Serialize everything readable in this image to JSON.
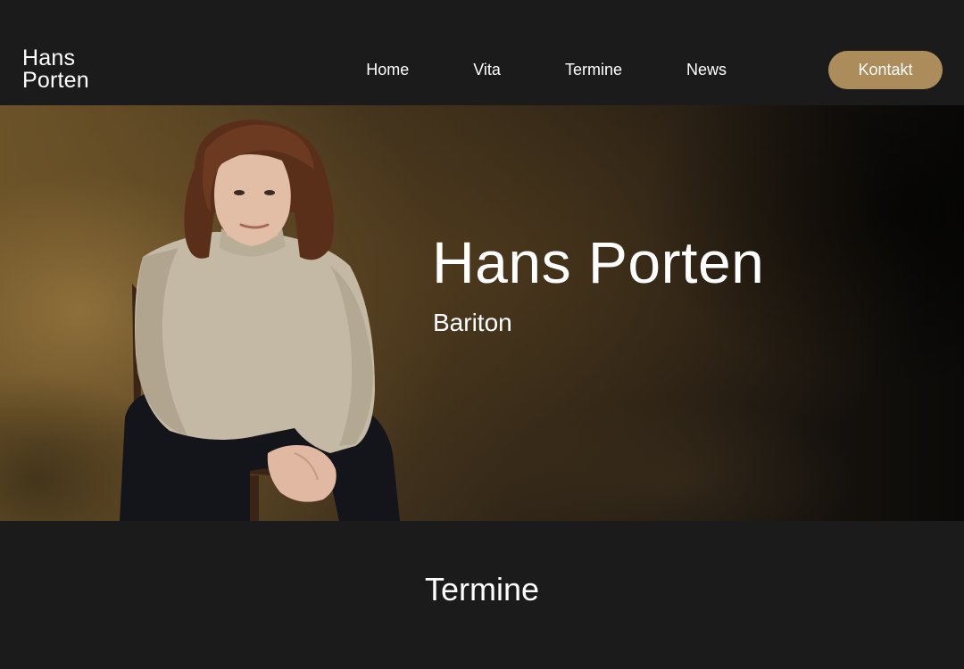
{
  "header": {
    "logo_line1": "Hans",
    "logo_line2": "Porten",
    "nav": {
      "home": "Home",
      "vita": "Vita",
      "termine": "Termine",
      "news": "News",
      "kontakt": "Kontakt"
    }
  },
  "hero": {
    "title": "Hans Porten",
    "subtitle": "Bariton",
    "image_alt": "portrait-photo"
  },
  "section": {
    "title": "Termine"
  },
  "colors": {
    "background": "#1b1b1b",
    "accent": "#ad8c5b",
    "text": "#ffffff"
  }
}
